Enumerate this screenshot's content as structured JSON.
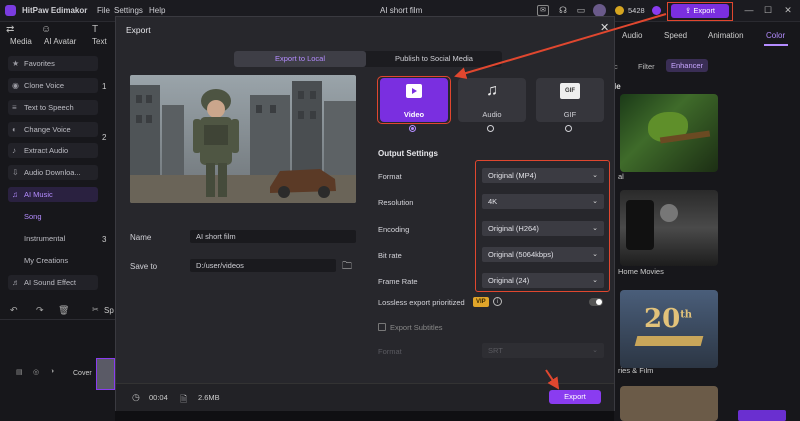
{
  "app": {
    "name": "HitPaw Edimakor",
    "menu": [
      "File",
      "Settings",
      "Help"
    ],
    "project_title": "AI short film",
    "credits": "5428",
    "export_label": "Export"
  },
  "toolbar_left": [
    "Media",
    "AI Avatar",
    "Text"
  ],
  "right_tabs": [
    "Audio",
    "Speed",
    "Animation",
    "Color"
  ],
  "right_subtabs": [
    "Filter",
    "Enhancer"
  ],
  "right_partial": {
    "le": "le",
    "al": "al",
    "home_movies": "Home Movies",
    "series_film": "ries & Film"
  },
  "sidebar": {
    "items": [
      "Favorites",
      "Clone Voice",
      "Text to Speech",
      "Change Voice",
      "Extract Audio",
      "Audio Downloa...",
      "AI Music"
    ],
    "ai_music_sub": [
      "Song",
      "Instrumental",
      "My Creations"
    ],
    "sound_effect": "AI Sound Effect"
  },
  "step_numbers": [
    "1",
    "2",
    "3"
  ],
  "timeline": {
    "cover": "Cover",
    "split": "Sp"
  },
  "dialog": {
    "title": "Export",
    "tabs": [
      "Export to Local",
      "Publish to Social Media"
    ],
    "name_label": "Name",
    "name_value": "AI short film",
    "save_label": "Save to",
    "save_value": "D:/user/videos",
    "formats": [
      {
        "label": "Video",
        "icon": "video-icon",
        "selected": true
      },
      {
        "label": "Audio",
        "icon": "music-icon",
        "selected": false
      },
      {
        "label": "GIF",
        "icon": "gif-icon",
        "selected": false
      }
    ],
    "gif_tag": "GIF",
    "output_settings": "Output Settings",
    "settings": [
      {
        "label": "Format",
        "value": "Original (MP4)"
      },
      {
        "label": "Resolution",
        "value": "4K"
      },
      {
        "label": "Encoding",
        "value": "Original (H264)"
      },
      {
        "label": "Bit rate",
        "value": "Original (5064kbps)"
      },
      {
        "label": "Frame Rate",
        "value": "Original (24)"
      }
    ],
    "lossless_label": "Lossless export prioritized",
    "vip_badge": "VIP",
    "subtitles_label": "Export Subtitles",
    "sub_format_label": "Format",
    "sub_format_value": "SRT",
    "duration": "00:04",
    "size": "2.6MB",
    "export_button": "Export"
  },
  "colors": {
    "accent": "#8a3cf0",
    "highlight": "#e0472f"
  }
}
